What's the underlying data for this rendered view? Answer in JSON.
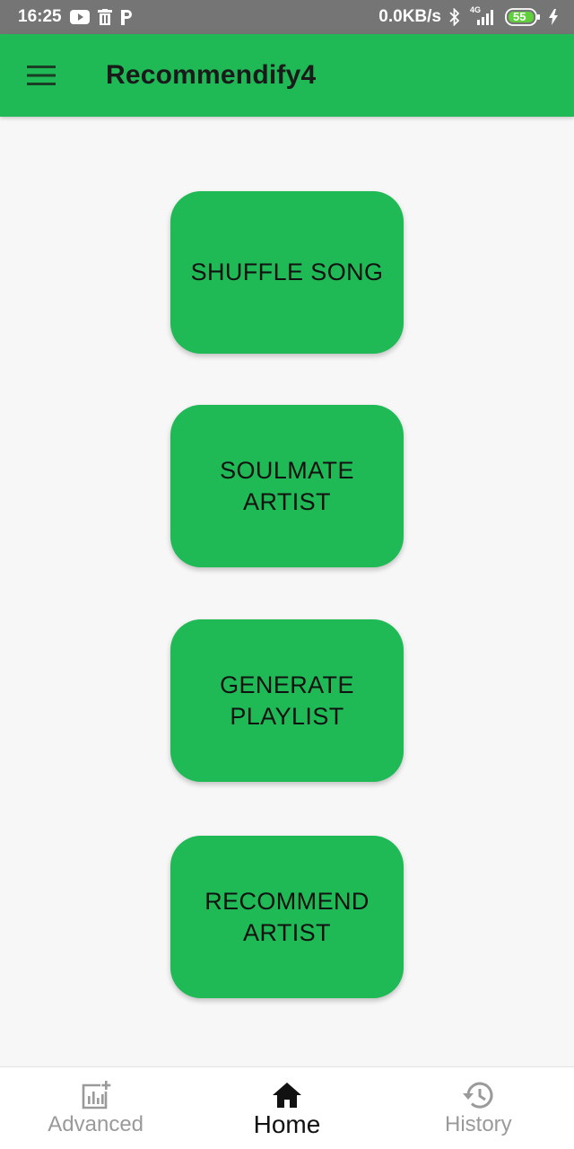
{
  "status_bar": {
    "time": "16:25",
    "left_icons": [
      "youtube-icon",
      "trash-icon",
      "parking-icon"
    ],
    "network_speed": "0.0KB/s",
    "network_type": "4G",
    "battery_level": "55",
    "right_icons": [
      "bluetooth-icon",
      "signal-icon",
      "battery-icon",
      "charging-icon"
    ]
  },
  "app_bar": {
    "menu_icon": "hamburger-menu-icon",
    "title": "Recommendify4",
    "color": "#1fba56"
  },
  "main": {
    "buttons": [
      {
        "label": "SHUFFLE SONG"
      },
      {
        "label": "SOULMATE\nARTIST"
      },
      {
        "label": "GENERATE\nPLAYLIST"
      },
      {
        "label": "RECOMMEND\nARTIST"
      }
    ]
  },
  "bottom_nav": {
    "items": [
      {
        "label": "Advanced",
        "icon": "chart-add-icon",
        "active": false
      },
      {
        "label": "Home",
        "icon": "home-icon",
        "active": true
      },
      {
        "label": "History",
        "icon": "history-icon",
        "active": false
      }
    ]
  }
}
